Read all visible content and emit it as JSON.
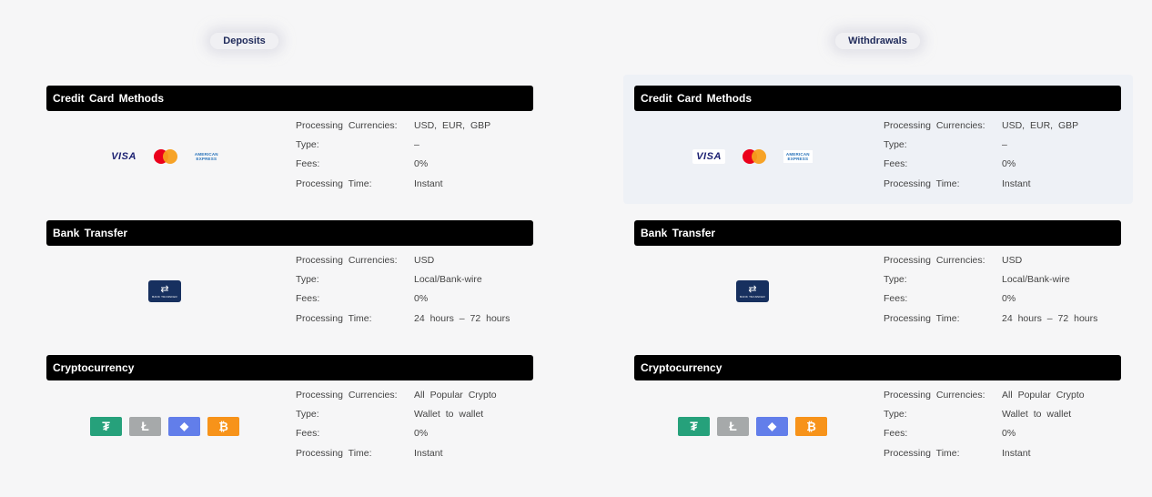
{
  "columns": [
    {
      "title": "Deposits",
      "sections": [
        {
          "heading": "Credit Card Methods",
          "logos": {
            "visa": "VISA",
            "amex_line1": "AMERICAN",
            "amex_line2": "EXPRESS"
          },
          "rows": [
            {
              "key": "Processing Currencies:",
              "value": "USD, EUR, GBP"
            },
            {
              "key": "Type:",
              "value": "–"
            },
            {
              "key": "Fees:",
              "value": "0%"
            },
            {
              "key": "Processing Time:",
              "value": "Instant"
            }
          ]
        },
        {
          "heading": "Bank Transfer",
          "logos": {
            "bank_symbol": "⇄",
            "bank_text": "BANK TRANSFER"
          },
          "rows": [
            {
              "key": "Processing Currencies:",
              "value": "USD"
            },
            {
              "key": "Type:",
              "value": "Local/Bank-wire"
            },
            {
              "key": "Fees:",
              "value": "0%"
            },
            {
              "key": "Processing Time:",
              "value": "24 hours – 72 hours"
            }
          ]
        },
        {
          "heading": "Cryptocurrency",
          "logos": {
            "usdt": "₮",
            "ltc": "Ł",
            "eth": "◆",
            "btc": "₿"
          },
          "rows": [
            {
              "key": "Processing Currencies:",
              "value": "All Popular Crypto"
            },
            {
              "key": "Type:",
              "value": "Wallet to wallet"
            },
            {
              "key": "Fees:",
              "value": "0%"
            },
            {
              "key": "Processing Time:",
              "value": "Instant"
            }
          ]
        }
      ]
    },
    {
      "title": "Withdrawals",
      "sections": [
        {
          "heading": "Credit Card Methods",
          "logos": {
            "visa": "VISA",
            "amex_line1": "AMERICAN",
            "amex_line2": "EXPRESS"
          },
          "rows": [
            {
              "key": "Processing Currencies:",
              "value": "USD, EUR, GBP"
            },
            {
              "key": "Type:",
              "value": "–"
            },
            {
              "key": "Fees:",
              "value": "0%"
            },
            {
              "key": "Processing Time:",
              "value": "Instant"
            }
          ]
        },
        {
          "heading": "Bank Transfer",
          "logos": {
            "bank_symbol": "⇄",
            "bank_text": "BANK TRANSFER"
          },
          "rows": [
            {
              "key": "Processing Currencies:",
              "value": "USD"
            },
            {
              "key": "Type:",
              "value": "Local/Bank-wire"
            },
            {
              "key": "Fees:",
              "value": "0%"
            },
            {
              "key": "Processing Time:",
              "value": "24 hours – 72 hours"
            }
          ]
        },
        {
          "heading": "Cryptocurrency",
          "logos": {
            "usdt": "₮",
            "ltc": "Ł",
            "eth": "◆",
            "btc": "₿"
          },
          "rows": [
            {
              "key": "Processing Currencies:",
              "value": "All Popular Crypto"
            },
            {
              "key": "Type:",
              "value": "Wallet to wallet"
            },
            {
              "key": "Fees:",
              "value": "0%"
            },
            {
              "key": "Processing Time:",
              "value": "Instant"
            }
          ]
        }
      ]
    }
  ],
  "colors": {
    "background": "#f6f6f7",
    "header_bar": "#000000",
    "column_title": "#1f2a5a",
    "visa": "#1a1f71",
    "mastercard_red": "#eb001b",
    "mastercard_orange": "#f79e1b",
    "amex": "#2671b9",
    "bank": "#17305f",
    "tether": "#26a17b",
    "litecoin": "#a6a9aa",
    "ethereum": "#627eea",
    "bitcoin": "#f7931a"
  },
  "icons": [
    "visa-icon",
    "mastercard-icon",
    "amex-icon",
    "bank-transfer-icon",
    "tether-icon",
    "litecoin-icon",
    "ethereum-icon",
    "bitcoin-icon"
  ]
}
